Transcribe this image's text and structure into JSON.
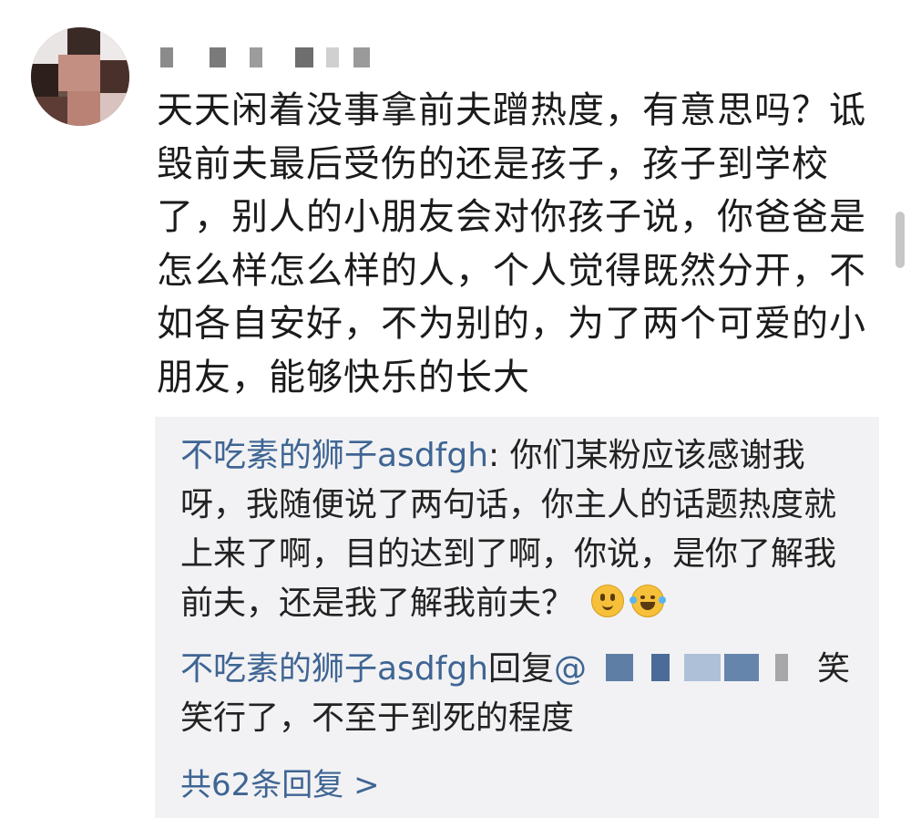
{
  "comment": {
    "text": "天天闲着没事拿前夫蹭热度，有意思吗？诋毁前夫最后受伤的还是孩子，孩子到学校了，别人的小朋友会对你孩子说，你爸爸是怎么样怎么样的人，个人觉得既然分开，不如各自安好，不为别的，为了两个可爱的小朋友，能够快乐的长大"
  },
  "replies": [
    {
      "author": "不吃素的狮子asdfgh",
      "separator": ": ",
      "text": "你们某粉应该感谢我呀，我随便说了两句话，你主人的话题热度就上来了啊，目的达到了啊，你说，是你了解我前夫，还是我了解我前夫？",
      "emojis": [
        "thinking-face-emoji",
        "tears-of-joy-emoji"
      ]
    },
    {
      "author": "不吃素的狮子asdfgh",
      "reply_word": "回复",
      "mention": "@",
      "text": "笑笑行了，不至于到死的程度"
    }
  ],
  "more_replies": {
    "label": "共62条回复 >"
  },
  "colors": {
    "link_blue": "#3f6593",
    "reply_background": "#f2f2f4"
  }
}
